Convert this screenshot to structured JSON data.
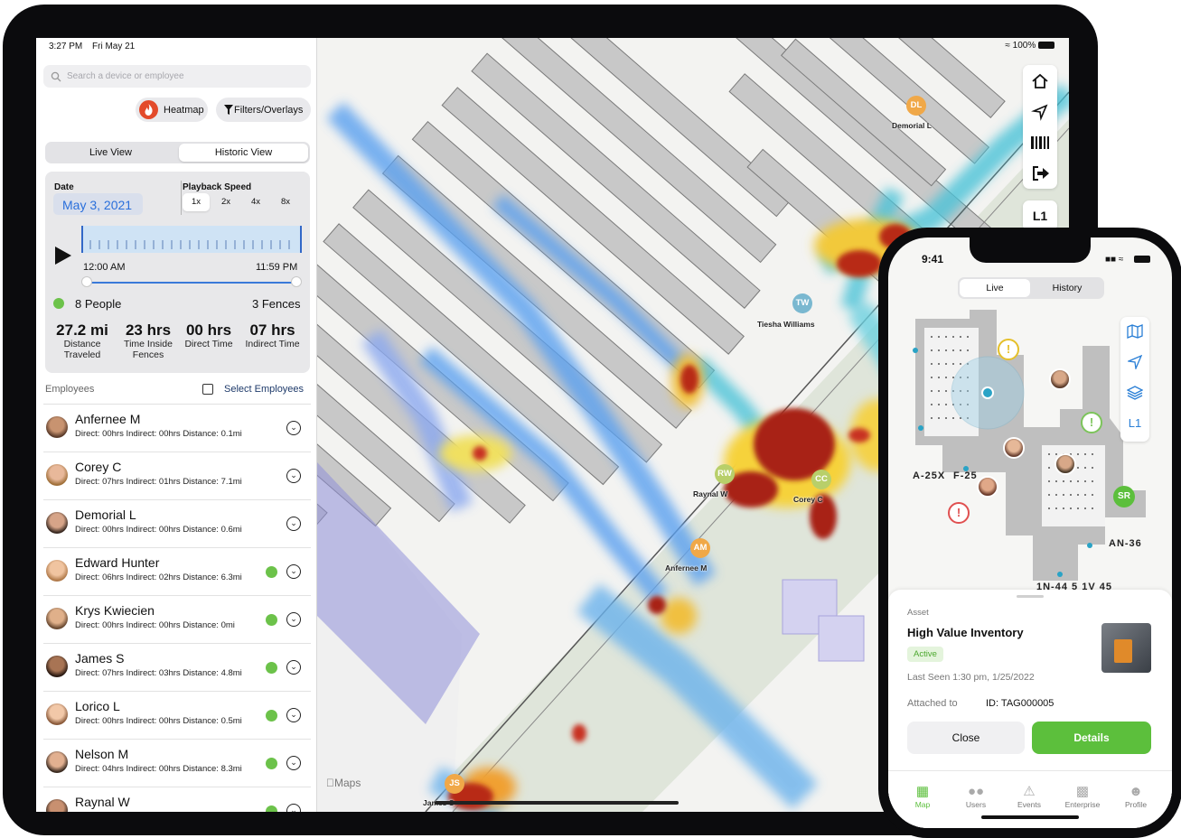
{
  "ipad": {
    "status": {
      "time": "3:27 PM",
      "date": "Fri May 21",
      "battery": "100%"
    },
    "search": {
      "placeholder": "Search a device or employee"
    },
    "buttons": {
      "heatmap": "Heatmap",
      "filters": "Filters/Overlays"
    },
    "view_tabs": {
      "live": "Live View",
      "historic": "Historic View",
      "selected": "Historic View"
    },
    "history": {
      "date_label": "Date",
      "date_value": "May 3, 2021",
      "speed_label": "Playback Speed",
      "speeds": [
        "1x",
        "2x",
        "4x",
        "8x"
      ],
      "selected_speed": "1x",
      "start_time": "12:00 AM",
      "end_time": "11:59 PM",
      "people": "8 People",
      "fences": "3 Fences",
      "stats": [
        {
          "value": "27.2 mi",
          "label": "Distance Traveled"
        },
        {
          "value": "23 hrs",
          "label": "Time Inside Fences"
        },
        {
          "value": "00 hrs",
          "label": "Direct Time"
        },
        {
          "value": "07 hrs",
          "label": "Indirect Time"
        }
      ]
    },
    "employees_header": "Employees",
    "select_employees": "Select Employees",
    "employees": [
      {
        "name": "Anfernee M",
        "detail": "Direct: 00hrs Indirect: 00hrs Distance: 0.1mi",
        "active": false
      },
      {
        "name": "Corey C",
        "detail": "Direct: 07hrs Indirect: 01hrs Distance: 7.1mi",
        "active": false
      },
      {
        "name": "Demorial L",
        "detail": "Direct: 00hrs Indirect: 00hrs Distance: 0.6mi",
        "active": false
      },
      {
        "name": "Edward Hunter",
        "detail": "Direct: 06hrs Indirect: 02hrs Distance: 6.3mi",
        "active": true
      },
      {
        "name": "Krys Kwiecien",
        "detail": "Direct: 00hrs Indirect: 00hrs Distance: 0mi",
        "active": true
      },
      {
        "name": "James S",
        "detail": "Direct: 07hrs Indirect: 03hrs Distance: 4.8mi",
        "active": true
      },
      {
        "name": "Lorico L",
        "detail": "Direct: 00hrs Indirect: 00hrs Distance: 0.5mi",
        "active": true
      },
      {
        "name": "Nelson M",
        "detail": "Direct: 04hrs Indirect: 00hrs Distance: 8.3mi",
        "active": true
      },
      {
        "name": "Raynal W",
        "detail": "",
        "active": true
      }
    ],
    "map": {
      "floor": "L1",
      "attribution": "Maps",
      "markers": [
        {
          "initials": "DL",
          "label": "Demorial L",
          "color": "#f0a848"
        },
        {
          "initials": "TW",
          "label": "Tiesha Williams",
          "color": "#7ab8d0"
        },
        {
          "initials": "RW",
          "label": "Raynal W",
          "color": "#b8cf6a"
        },
        {
          "initials": "CC",
          "label": "Corey C",
          "color": "#b8cf6a"
        },
        {
          "initials": "AM",
          "label": "Anfernee M",
          "color": "#f0a848"
        },
        {
          "initials": "JS",
          "label": "James S",
          "color": "#f0a848"
        }
      ],
      "controls": [
        "home-icon",
        "locate-icon",
        "barcode-icon",
        "exit-icon"
      ]
    }
  },
  "iphone": {
    "status": {
      "time": "9:41"
    },
    "tabs": {
      "live": "Live",
      "history": "History",
      "selected": "Live"
    },
    "floor": "L1",
    "zone_labels": [
      "A-25X",
      "F-25",
      "AN-36",
      "1N-44",
      "5",
      "1V",
      "45"
    ],
    "marker_initials": "SR",
    "asset": {
      "kind": "Asset",
      "name": "High Value Inventory",
      "status": "Active",
      "last_seen": "Last Seen 1:30 pm, 1/25/2022",
      "attached_label": "Attached to",
      "attached_value": "ID: TAG000005",
      "close": "Close",
      "details": "Details"
    },
    "tabbar": [
      "Map",
      "Users",
      "Events",
      "Enterprise",
      "Profile"
    ],
    "tabbar_selected": "Map",
    "accent": "#5cbf3c"
  }
}
